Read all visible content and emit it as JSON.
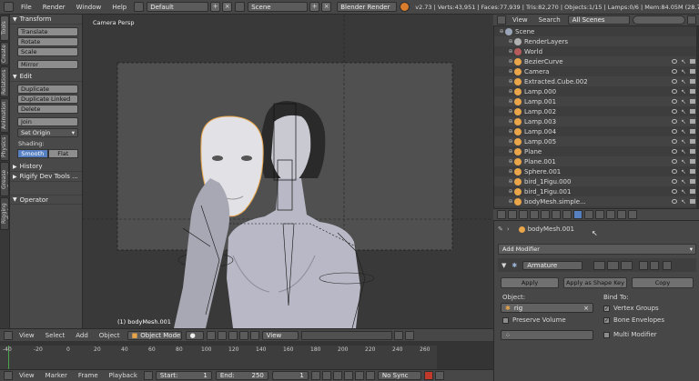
{
  "topbar": {
    "menus": [
      "File",
      "Render",
      "Window",
      "Help"
    ],
    "screen": "Default",
    "scene": "Scene",
    "engine": "Blender Render",
    "stats": "v2.73 | Verts:43,951 | Faces:77,939 | Tris:82,270 | Objects:1/15 | Lamps:0/6 | Mem:84.05M (28.79M) | bodyMesh.001"
  },
  "tool_tabs": [
    "Tools",
    "Create",
    "Relations",
    "Animation",
    "Physics",
    "Grease Pencil",
    "Rigging Tool"
  ],
  "tool_shelf": {
    "transform_header": "Transform",
    "transform_buttons": [
      "Translate",
      "Rotate",
      "Scale"
    ],
    "mirror": "Mirror",
    "edit_header": "Edit",
    "edit_buttons": [
      "Duplicate",
      "Duplicate Linked",
      "Delete"
    ],
    "join": "Join",
    "set_origin": "Set Origin",
    "shading_label": "Shading:",
    "smooth": "Smooth",
    "flat": "Flat",
    "history_header": "History",
    "rigify_header": "Rigify Dev Tools ...",
    "operator_header": "Operator"
  },
  "viewport": {
    "label": "Camera Persp",
    "object_label": "(1) bodyMesh.001"
  },
  "viewport_header": {
    "menus": [
      "View",
      "Select",
      "Add",
      "Object"
    ],
    "mode": "Object Mode",
    "view_sel": "View"
  },
  "outliner": {
    "menus": [
      "View",
      "Search"
    ],
    "filter": "All Scenes",
    "items": [
      {
        "name": "Scene",
        "indent": 0,
        "color": "#9aa6b8",
        "vis": false
      },
      {
        "name": "RenderLayers",
        "indent": 1,
        "color": "#b0b0b0",
        "vis": false
      },
      {
        "name": "World",
        "indent": 1,
        "color": "#b55b5b",
        "vis": false
      },
      {
        "name": "BezierCurve",
        "indent": 1,
        "color": "#e8a54a",
        "vis": true
      },
      {
        "name": "Camera",
        "indent": 1,
        "color": "#e8a54a",
        "vis": true
      },
      {
        "name": "Extracted.Cube.002",
        "indent": 1,
        "color": "#e8a54a",
        "vis": true
      },
      {
        "name": "Lamp.000",
        "indent": 1,
        "color": "#e8a54a",
        "vis": true
      },
      {
        "name": "Lamp.001",
        "indent": 1,
        "color": "#e8a54a",
        "vis": true
      },
      {
        "name": "Lamp.002",
        "indent": 1,
        "color": "#e8a54a",
        "vis": true
      },
      {
        "name": "Lamp.003",
        "indent": 1,
        "color": "#e8a54a",
        "vis": true
      },
      {
        "name": "Lamp.004",
        "indent": 1,
        "color": "#e8a54a",
        "vis": true
      },
      {
        "name": "Lamp.005",
        "indent": 1,
        "color": "#e8a54a",
        "vis": true
      },
      {
        "name": "Plane",
        "indent": 1,
        "color": "#e8a54a",
        "vis": true
      },
      {
        "name": "Plane.001",
        "indent": 1,
        "color": "#e8a54a",
        "vis": true
      },
      {
        "name": "Sphere.001",
        "indent": 1,
        "color": "#e8a54a",
        "vis": true
      },
      {
        "name": "bird_1Figu.000",
        "indent": 1,
        "color": "#e8a54a",
        "vis": true
      },
      {
        "name": "bird_1Figu.001",
        "indent": 1,
        "color": "#e8a54a",
        "vis": true
      },
      {
        "name": "bodyMesh.simple...",
        "indent": 1,
        "color": "#e8a54a",
        "vis": true
      }
    ]
  },
  "properties": {
    "object_name": "bodyMesh.001",
    "add_modifier": "Add Modifier",
    "modifier_name": "Armature",
    "apply": "Apply",
    "apply_shape": "Apply as Shape Key",
    "copy": "Copy",
    "object_label": "Object:",
    "object_value": "rig",
    "bind_to": "Bind To:",
    "vertex_groups": "Vertex Groups",
    "bone_envelopes": "Bone Envelopes",
    "preserve_volume": "Preserve Volume",
    "multi_modifier": "Multi Modifier"
  },
  "timeline": {
    "ticks": [
      "-40",
      "-20",
      "0",
      "20",
      "40",
      "60",
      "80",
      "100",
      "120",
      "140",
      "160",
      "180",
      "200",
      "220",
      "240",
      "260"
    ]
  },
  "bottom_header": {
    "menus": [
      "View",
      "Marker",
      "Frame",
      "Playback"
    ],
    "start_label": "Start:",
    "start_value": "1",
    "end_label": "End:",
    "end_value": "250",
    "current": "1",
    "sync": "No Sync"
  }
}
